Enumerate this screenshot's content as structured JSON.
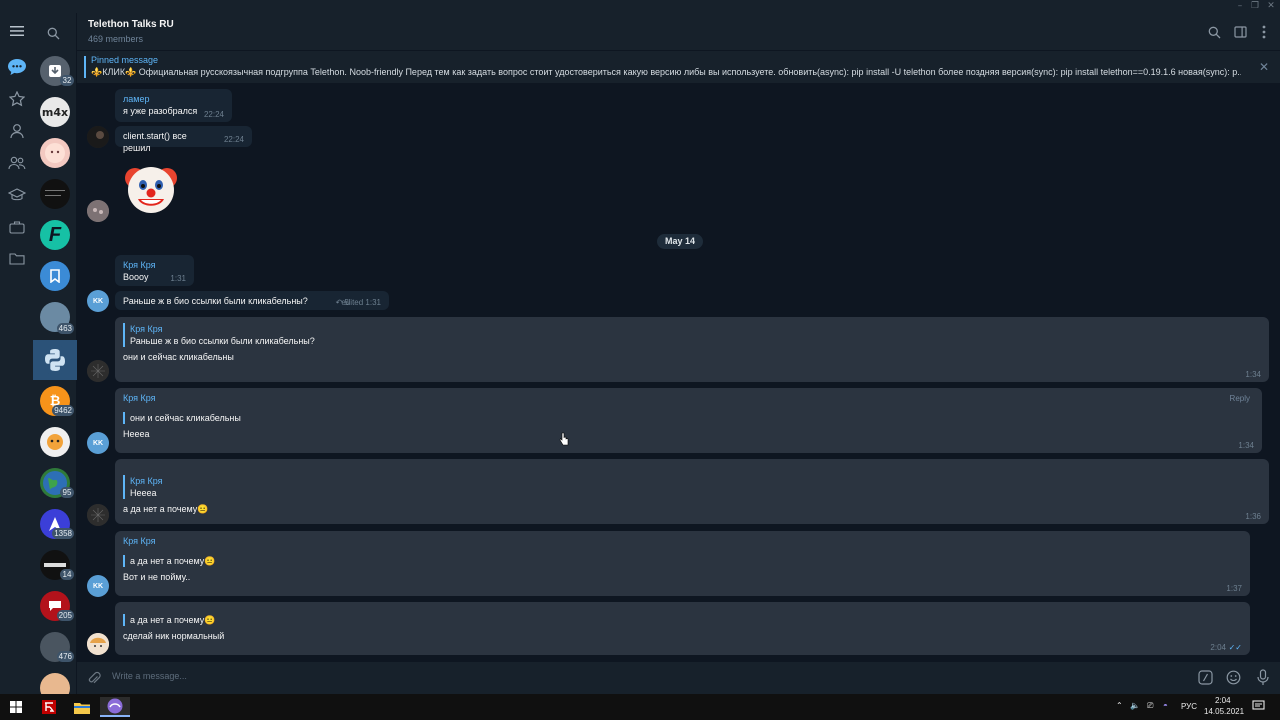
{
  "header": {
    "title": "Telethon Talks RU",
    "subtitle": "469 members"
  },
  "pinned": {
    "label": "Pinned message",
    "text": "⚜️КЛИК⚜️ Официальная русскоязычная подгруппа Telethon. Noob-friendly Перед тем как задать вопрос стоит удостовериться какую версию либы вы используете.  обновить(async): pip install -U telethon более поздняя версия(sync): pip install telethon==0.19.1.6 новая(sync): p..."
  },
  "chat_list": {
    "badges": [
      "32",
      "463",
      "9462",
      "95",
      "1358",
      "14",
      "205",
      "476"
    ]
  },
  "messages": [
    {
      "name": "ламер",
      "text": "я уже разобрался",
      "time": "22:24"
    },
    {
      "text": "client.start() все решил",
      "time": "22:24"
    },
    {
      "date": "May 14"
    },
    {
      "name": "Кря Кря",
      "text": "Boooy",
      "time": "1:31",
      "avatar": "KK"
    },
    {
      "text": "Раньше ж в био ссылки были кликабельны?",
      "replies": "5",
      "time": "edited 1:31",
      "avatar": "KK"
    },
    {
      "quote_name": "Кря Кря",
      "quote_text": "Раньше ж в био ссылки были кликабельны?",
      "text": "они и сейчас кликабельны",
      "time": "1:34"
    },
    {
      "name": "Кря Кря",
      "reply": "Reply",
      "quote_text": "они и сейчас кликабельны",
      "text": "Нееeа",
      "time": "1:34",
      "avatar": "KK"
    },
    {
      "quote_name": "Кря Кря",
      "quote_text": "Нееeа",
      "text": "а да нет а почему😐",
      "time": "1:36"
    },
    {
      "name": "Кря Кря",
      "quote_text": "а да нет а почему😐",
      "text": "Вот и не пойму..",
      "time": "1:37",
      "avatar": "KK"
    },
    {
      "quote_text": "а да нет а почему😐",
      "text": "сделай ник нормальный",
      "time": "2:04"
    }
  ],
  "input": {
    "placeholder": "Write a message..."
  },
  "taskbar": {
    "lang": "РУС",
    "time": "2:04",
    "date": "14.05.2021"
  },
  "colors": {
    "accent": "#5eb5f7",
    "bg": "#0e1621",
    "panel": "#17212b",
    "bubble": "#182533",
    "active_chat": "#2b5278"
  }
}
